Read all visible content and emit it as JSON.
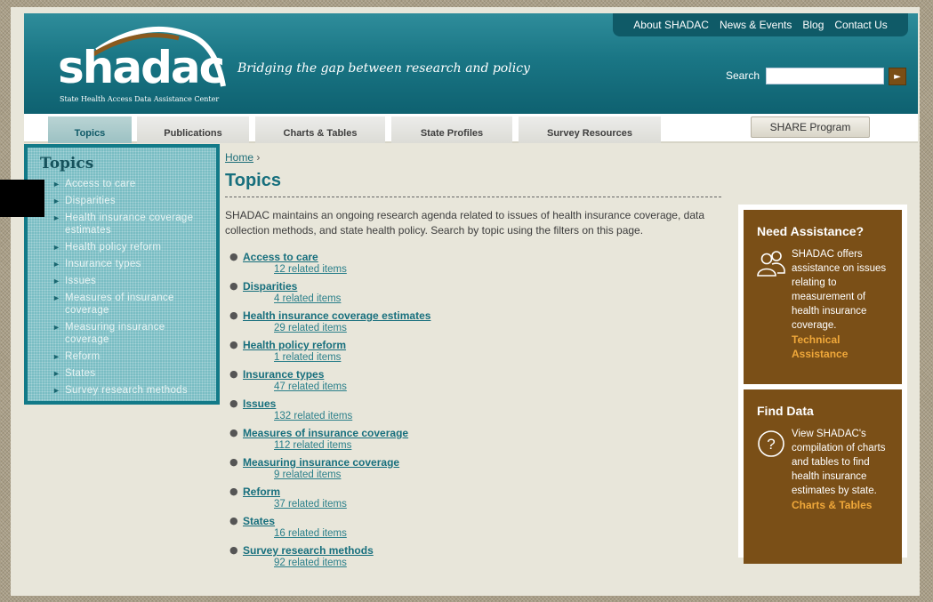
{
  "brand": {
    "logo_text": "shadac",
    "logo_subtitle": "State Health Access Data Assistance Center",
    "tagline": "Bridging the gap between research and policy"
  },
  "utility_nav": [
    "About SHADAC",
    "News & Events",
    "Blog",
    "Contact Us"
  ],
  "search": {
    "label": "Search",
    "placeholder": "",
    "button": "►"
  },
  "main_nav": {
    "tabs": [
      "Topics",
      "Publications",
      "Charts & Tables",
      "State Profiles",
      "Survey Resources"
    ],
    "active": "Topics",
    "share_button": "SHARE Program"
  },
  "sidebar": {
    "title": "Topics",
    "items": [
      "Access to care",
      "Disparities",
      "Health insurance coverage estimates",
      "Health policy reform",
      "Insurance types",
      "Issues",
      "Measures of insurance coverage",
      "Measuring insurance coverage",
      "Reform",
      "States",
      "Survey research methods"
    ]
  },
  "breadcrumb": {
    "home": "Home",
    "separator": "›"
  },
  "page": {
    "title": "Topics",
    "intro": "SHADAC maintains an ongoing research agenda related to issues of health insurance coverage, data collection methods, and state health policy. Search by topic using the filters on this page."
  },
  "topics": [
    {
      "name": "Access to care",
      "count": "12 related items"
    },
    {
      "name": "Disparities",
      "count": "4 related items"
    },
    {
      "name": "Health insurance coverage estimates",
      "count": "29 related items"
    },
    {
      "name": "Health policy reform",
      "count": "1 related items"
    },
    {
      "name": "Insurance types",
      "count": "47 related items"
    },
    {
      "name": "Issues",
      "count": "132 related items"
    },
    {
      "name": "Measures of insurance coverage",
      "count": "112 related items"
    },
    {
      "name": "Measuring insurance coverage",
      "count": "9 related items"
    },
    {
      "name": "Reform",
      "count": "37 related items"
    },
    {
      "name": "States",
      "count": "16 related items"
    },
    {
      "name": "Survey research methods",
      "count": "92 related items"
    }
  ],
  "promos": {
    "assistance": {
      "title": "Need Assistance?",
      "body": "SHADAC offers assistance on issues relating to measurement of health insurance coverage.",
      "link": "Technical Assistance",
      "icon": "people-icon"
    },
    "data": {
      "title": "Find Data",
      "body": "View SHADAC's compilation of charts and tables to find health insurance estimates by state.",
      "link": "Charts & Tables",
      "icon": "question-icon"
    }
  },
  "colors": {
    "teal_header": "#1a7685",
    "teal_text": "#176f7d",
    "brown_promo": "#7a4f17",
    "orange_link": "#f0a83a",
    "page_bg": "#e8e6da"
  }
}
